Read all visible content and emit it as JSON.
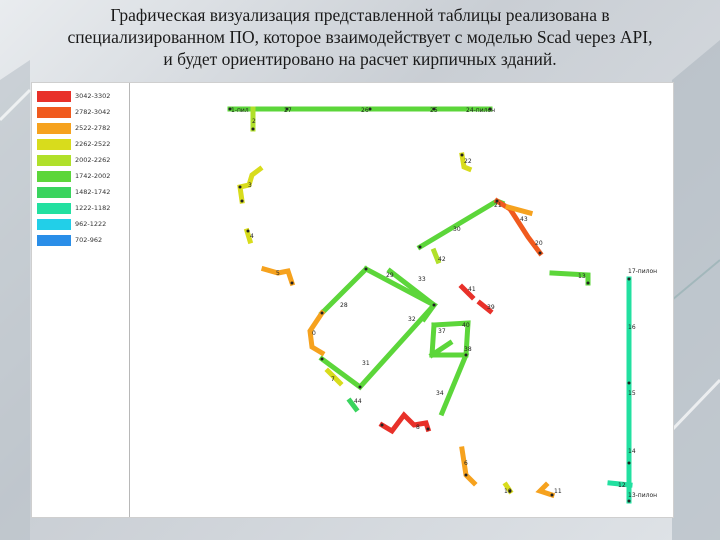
{
  "title": {
    "line1": "Графическая визуализация представленной таблицы реализована в",
    "line2": "специализированном ПО, которое взаимодействует с моделью Scad через API,",
    "line3": "и будет ориентировано на расчет кирпичных зданий."
  },
  "legend": [
    {
      "label": "3042-3302",
      "color": "#e8312a"
    },
    {
      "label": "2782-3042",
      "color": "#f05a1e"
    },
    {
      "label": "2522-2782",
      "color": "#f6a21e"
    },
    {
      "label": "2262-2522",
      "color": "#d8dc1c"
    },
    {
      "label": "2002-2262",
      "color": "#b0e02a"
    },
    {
      "label": "1742-2002",
      "color": "#5cd63a"
    },
    {
      "label": "1482-1742",
      "color": "#3ad45e"
    },
    {
      "label": "1222-1182",
      "color": "#22e0a0"
    },
    {
      "label": "962-1222",
      "color": "#22cfe8"
    },
    {
      "label": "702-962",
      "color": "#2a8ee8"
    }
  ],
  "wall_labels": [
    "1-пил",
    "27",
    "26",
    "25",
    "24-пилон",
    "2",
    "22",
    "3",
    "21",
    "43",
    "30",
    "4",
    "20",
    "42",
    "5",
    "29",
    "33",
    "13",
    "17-пилон",
    "41",
    "39",
    "28",
    "40",
    "16",
    "32",
    "37",
    "0",
    "38",
    "31",
    "7",
    "15",
    "34",
    "44",
    "8",
    "14",
    "6",
    "12",
    "10",
    "11",
    "13-пилон"
  ]
}
